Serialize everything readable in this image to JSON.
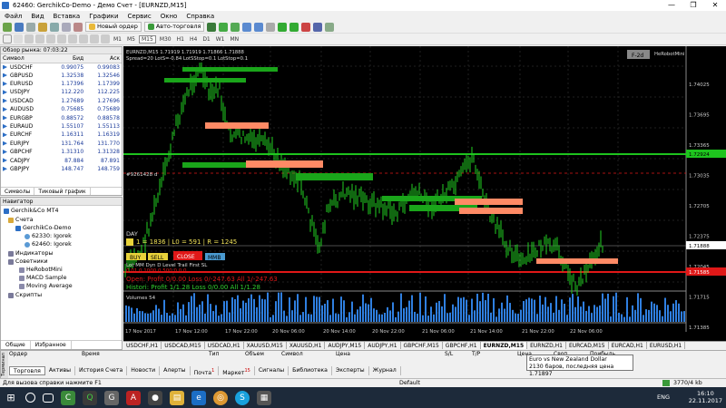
{
  "window": {
    "title": "62460: GerchikCo-Demo - Демо Счет - [EURNZD,M15]",
    "min": "—",
    "max": "❐",
    "close": "✕"
  },
  "menu": [
    "Файл",
    "Вид",
    "Вставка",
    "Графики",
    "Сервис",
    "Окно",
    "Справка"
  ],
  "toolbar": {
    "new_order": "Новый ордер",
    "autotrade": "Авто-торговля",
    "timeframes": [
      "M1",
      "M5",
      "M15",
      "M30",
      "H1",
      "H4",
      "D1",
      "W1",
      "MN"
    ],
    "active_tf": "M15"
  },
  "market_watch": {
    "title": "Обзор рынка: 07:03:22",
    "columns": [
      "Символ",
      "Бид",
      "Аск"
    ],
    "rows": [
      [
        "USDCHF",
        "0.99075",
        "0.99083"
      ],
      [
        "GBPUSD",
        "1.32538",
        "1.32546"
      ],
      [
        "EURUSD",
        "1.17396",
        "1.17399"
      ],
      [
        "USDJPY",
        "112.220",
        "112.225"
      ],
      [
        "USDCAD",
        "1.27689",
        "1.27696"
      ],
      [
        "AUDUSD",
        "0.75685",
        "0.75689"
      ],
      [
        "EURGBP",
        "0.88572",
        "0.88578"
      ],
      [
        "EURAUD",
        "1.55107",
        "1.55113"
      ],
      [
        "EURCHF",
        "1.16311",
        "1.16319"
      ],
      [
        "EURJPY",
        "131.764",
        "131.770"
      ],
      [
        "GBPCHF",
        "1.31310",
        "1.31328"
      ],
      [
        "CADJPY",
        "87.884",
        "87.891"
      ],
      [
        "GBPJPY",
        "148.747",
        "148.759"
      ]
    ],
    "tabs": [
      "Символы",
      "Тиковый график"
    ]
  },
  "navigator": {
    "title": "Навигатор",
    "items": [
      "Gerchik&Co MT4",
      "Счета",
      "GerchikCo-Demo",
      "62330: Igorek",
      "62460: Igorek",
      "Индикаторы",
      "Советники",
      "HeRobotMini",
      "MACD Sample",
      "Moving Average",
      "Скрипты"
    ],
    "tabs": [
      "Общие",
      "Избранное"
    ]
  },
  "chart": {
    "header1": "EURNZD,M15  1.71919 1.71919 1.71866 1.71888",
    "header2": "Spread=20  LotS=-0.84  LotSStop=0.1  LotStop=0.1",
    "robot": "HeRobotMini",
    "badge": "F-2d",
    "order_label": "#9261428 d",
    "day": "DAY",
    "stats": "1 = 1836 | L0 = 591 | R = 1245",
    "btn_buy": "BUY",
    "btn_sell": "SELL",
    "btn_close": "CLOSE",
    "btn_mmb": "MMB",
    "params": "Lot   MM   Dyn    D     Level  Trail  First   SL",
    "params_vals": "0.01   0   1000   0    500   0   0   0",
    "open_line": "Open:  Profit 0/0.00  Loss 0/-247.63  All 1/-247.63",
    "hist_line": "Histori:  Profit 1/1.28  Loss 0/0.00  All 1/1.28",
    "volumes_label": "Volumes 54",
    "prices": [
      "1.74025",
      "1.73695",
      "1.73365",
      "1.73035",
      "1.72705",
      "1.72375",
      "1.72045",
      "1.71715",
      "1.71385"
    ],
    "price_green": "1.72924",
    "price_cur": "1.71888",
    "price_red": "1.71585",
    "times": [
      "17 Nov 2017",
      "17 Nov 12:00",
      "17 Nov 22:00",
      "20 Nov 06:00",
      "20 Nov 14:00",
      "20 Nov 22:00",
      "21 Nov 06:00",
      "21 Nov 14:00",
      "21 Nov 22:00",
      "22 Nov 06:00"
    ]
  },
  "chart_tabs": [
    "USDCHF,H1",
    "USDCAD,M15",
    "USDCAD,H1",
    "XAUUSD,M15",
    "XAUUSD,H1",
    "AUDJPY,M15",
    "AUDJPY,H1",
    "GBPCHF,M15",
    "GBPCHF,H1",
    "EURNZD,M15",
    "EURNZD,H1",
    "EURCAD,M15",
    "EURCAD,H1",
    "EURUSD,H1"
  ],
  "active_chart_tab": "EURNZD,M15",
  "terminal": {
    "side": "Терминал",
    "head": [
      "Ордер",
      "Время",
      "Тип",
      "Объем",
      "Символ",
      "Цена",
      "S/L",
      "T/P",
      "Цена",
      "Своп",
      "Прибыль"
    ],
    "tabs": [
      "Торговля",
      "Активы",
      "История Счета",
      "Новости",
      "Алерты",
      "Почта",
      "Маркет",
      "Сигналы",
      "Библиотека",
      "Эксперты",
      "Журнал"
    ],
    "mail_badge": "1",
    "market_badge": "15"
  },
  "tooltip": {
    "line1": "Euro vs New Zealand Dollar",
    "line2": "2130 баров, последняя цена 1.71897"
  },
  "status": {
    "help": "Для вызова справки нажмите F1",
    "profile": "Default",
    "traffic": "3770/4 kb"
  },
  "taskbar": {
    "lang": "ENG",
    "time": "16:10",
    "date": "22.11.2017"
  }
}
